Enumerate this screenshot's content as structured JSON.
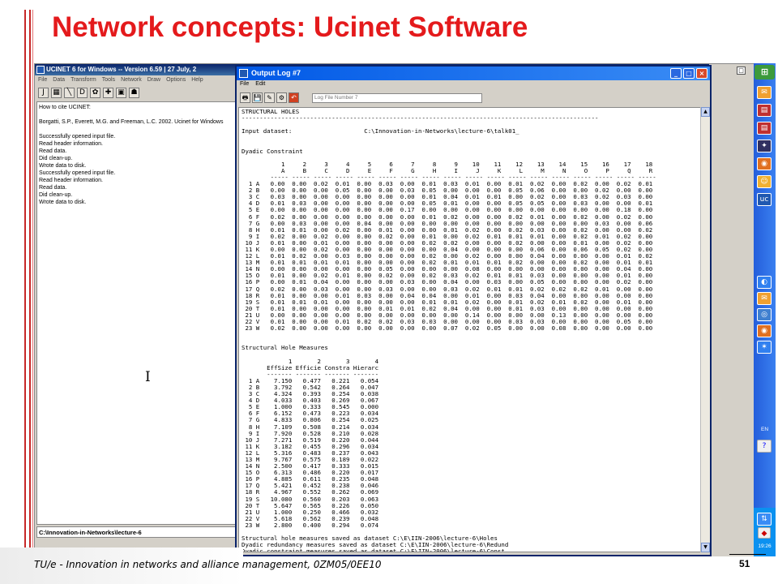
{
  "slide": {
    "title": "Network concepts: Ucinet Software",
    "footer": "TU/e - Innovation in networks and alliance management, 0ZM05/0EE10",
    "page_number": "51"
  },
  "main_window": {
    "title": "UCINET 6 for Windows -- Version 6.59  |  27 July, 2",
    "menu": [
      "File",
      "Data",
      "Transform",
      "Tools",
      "Network",
      "Draw",
      "Options",
      "Help"
    ],
    "toolbar_icons": [
      "J",
      "▦",
      "╲",
      "D",
      "✿",
      "✚",
      "▣",
      "☗"
    ],
    "log_lines": [
      "How to cite UCINET:",
      "",
      "Borgatti, S.P., Everett, M.G. and Freeman, L.C. 2002. Ucinet for Windows",
      "",
      "Successfully opened input file.",
      "Read header information.",
      "Read data.",
      "Did clean-up.",
      "Wrote data to disk.",
      "Successfully opened input file.",
      "Read header information.",
      "Read data.",
      "Did clean-up.",
      "Wrote data to disk."
    ],
    "status_path": "C:\\Innovation-in-Networks\\lecture-6"
  },
  "output_window": {
    "title": "Output Log #7",
    "menu": [
      "File",
      "Edit"
    ],
    "toolbar_icons": [
      "🖶",
      "💾",
      "✎",
      "⚙",
      "↶"
    ],
    "log_name_placeholder": "Log File Number 7",
    "controls": [
      "_",
      "□",
      "×"
    ],
    "text": [
      "STRUCTURAL HOLES",
      "---------------------------------------------------------------------------------------------------",
      "",
      "Input dataset:                    C:\\Innovation-in-Networks\\lecture-6\\talk01_",
      "",
      "",
      "Dyadic Constraint",
      "",
      "           1     2     3     4     5     6     7     8     9    10    11    12    13    14    15    16    17    18",
      "           A     B     C     D     E     F     G     H     I     J     K     L     M     N     O     P     Q     R",
      "        ----- ----- ----- ----- ----- ----- ----- ----- ----- ----- ----- ----- ----- ----- ----- ----- ----- -----",
      "  1 A   0.00  0.00  0.02  0.01  0.00  0.03  0.00  0.01  0.03  0.01  0.00  0.01  0.02  0.00  0.02  0.00  0.02  0.01",
      "  2 B   0.00  0.00  0.00  0.05  0.00  0.00  0.03  0.05  0.00  0.00  0.00  0.05  0.06  0.00  0.00  0.02  0.00  0.00",
      "  3 C   0.03  0.00  0.00  0.00  0.00  0.00  0.00  0.01  0.04  0.01  0.01  0.00  0.02  0.00  0.03  0.02  0.03  0.00",
      "  4 D   0.01  0.03  0.00  0.00  0.00  0.00  0.00  0.05  0.01  0.00  0.00  0.05  0.05  0.00  0.03  0.00  0.00  0.01",
      "  5 E   0.00  0.00  0.00  0.00  0.00  0.00  0.17  0.00  0.00  0.00  0.00  0.00  0.00  0.00  0.00  0.00  0.18  0.00",
      "  6 F   0.02  0.00  0.00  0.00  0.00  0.00  0.00  0.01  0.02  0.00  0.00  0.02  0.01  0.00  0.02  0.00  0.02  0.00",
      "  7 G   0.00  0.03  0.00  0.00  0.04  0.00  0.00  0.00  0.00  0.00  0.00  0.00  0.00  0.00  0.00  0.03  0.00  0.06",
      "  8 H   0.01  0.01  0.00  0.02  0.00  0.01  0.00  0.00  0.01  0.02  0.00  0.02  0.03  0.00  0.02  0.00  0.00  0.02",
      "  9 I   0.02  0.00  0.02  0.00  0.00  0.02  0.00  0.01  0.00  0.02  0.01  0.01  0.01  0.00  0.02  0.01  0.02  0.00",
      " 10 J   0.01  0.00  0.01  0.00  0.00  0.00  0.00  0.02  0.02  0.00  0.00  0.02  0.00  0.00  0.01  0.00  0.02  0.00",
      " 11 K   0.00  0.00  0.02  0.00  0.00  0.00  0.00  0.00  0.04  0.00  0.00  0.00  0.06  0.00  0.06  0.05  0.02  0.00",
      " 12 L   0.01  0.02  0.00  0.03  0.00  0.00  0.00  0.02  0.00  0.02  0.00  0.00  0.04  0.00  0.00  0.00  0.01  0.02",
      " 13 M   0.01  0.01  0.01  0.01  0.00  0.00  0.00  0.02  0.01  0.01  0.01  0.02  0.00  0.00  0.02  0.00  0.01  0.01",
      " 14 N   0.00  0.00  0.00  0.00  0.00  0.05  0.00  0.00  0.00  0.08  0.00  0.00  0.00  0.00  0.00  0.00  0.04  0.00",
      " 15 O   0.01  0.00  0.02  0.01  0.00  0.02  0.00  0.02  0.03  0.02  0.01  0.01  0.03  0.00  0.00  0.00  0.01  0.00",
      " 16 P   0.00  0.01  0.04  0.00  0.00  0.00  0.03  0.00  0.04  0.00  0.03  0.00  0.05  0.00  0.00  0.00  0.02  0.00",
      " 17 Q   0.02  0.00  0.03  0.00  0.00  0.03  0.00  0.00  0.03  0.02  0.01  0.01  0.02  0.02  0.02  0.01  0.00  0.00",
      " 18 R   0.01  0.00  0.00  0.01  0.03  0.00  0.04  0.04  0.00  0.01  0.00  0.03  0.04  0.00  0.00  0.00  0.00  0.00",
      " 19 S   0.01  0.01  0.01  0.00  0.00  0.00  0.00  0.01  0.01  0.02  0.00  0.01  0.02  0.01  0.02  0.00  0.01  0.00",
      " 20 T   0.01  0.00  0.00  0.00  0.00  0.01  0.01  0.02  0.04  0.00  0.00  0.01  0.03  0.00  0.00  0.00  0.00  0.00",
      " 21 U   0.00  0.00  0.00  0.00  0.00  0.00  0.00  0.00  0.00  0.14  0.00  0.00  0.00  0.13  0.00  0.00  0.00  0.00",
      " 22 V   0.01  0.00  0.00  0.01  0.02  0.02  0.03  0.03  0.00  0.00  0.00  0.03  0.03  0.00  0.00  0.00  0.05  0.00",
      " 23 W   0.02  0.00  0.00  0.00  0.00  0.00  0.00  0.00  0.07  0.02  0.05  0.00  0.00  0.08  0.00  0.00  0.00  0.00",
      "",
      "",
      "Structural Hole Measures",
      "",
      "             1       2       3       4",
      "       EffSize Efficie Constra Hierarc",
      "       ------- ------- ------- -------",
      "  1 A    7.150   0.477   0.221   0.054",
      "  2 B    3.792   0.542   0.264   0.047",
      "  3 C    4.324   0.393   0.254   0.038",
      "  4 D    4.033   0.403   0.269   0.067",
      "  5 E    1.000   0.333   0.545   0.000",
      "  6 F    6.152   0.473   0.223   0.034",
      "  7 G    4.833   0.806   0.254   0.025",
      "  8 H    7.109   0.508   0.214   0.034",
      "  9 I    7.920   0.528   0.210   0.028",
      " 10 J    7.271   0.519   0.220   0.044",
      " 11 K    3.182   0.455   0.296   0.034",
      " 12 L    5.316   0.483   0.237   0.043",
      " 13 M    9.767   0.575   0.189   0.022",
      " 14 N    2.500   0.417   0.333   0.015",
      " 15 O    6.313   0.486   0.220   0.017",
      " 16 P    4.885   0.611   0.235   0.048",
      " 17 Q    5.421   0.452   0.238   0.046",
      " 18 R    4.967   0.552   0.262   0.069",
      " 19 S   10.080   0.560   0.203   0.063",
      " 20 T    5.647   0.565   0.226   0.050",
      " 21 U    1.000   0.250   0.466   0.032",
      " 22 V    5.618   0.562   0.239   0.048",
      " 23 W    2.800   0.400   0.294   0.074",
      "",
      "Structural hole measures saved as dataset C:\\E\\IIN-2006\\lecture-6\\Holes",
      "Dyadic redundancy measures saved as dataset C:\\E\\IIN-2006\\lecture-6\\Redund",
      "Dyadic constraint measures saved as dataset C:\\E\\IIN-2006\\lecture-6\\Const"
    ]
  },
  "taskbar": {
    "start_icon": "start-flag-icon",
    "language": "EN",
    "clock": "19:26"
  },
  "colors": {
    "title": "#e41a1c",
    "accent_bar": "#c62828",
    "taskbar": "#245edb"
  }
}
